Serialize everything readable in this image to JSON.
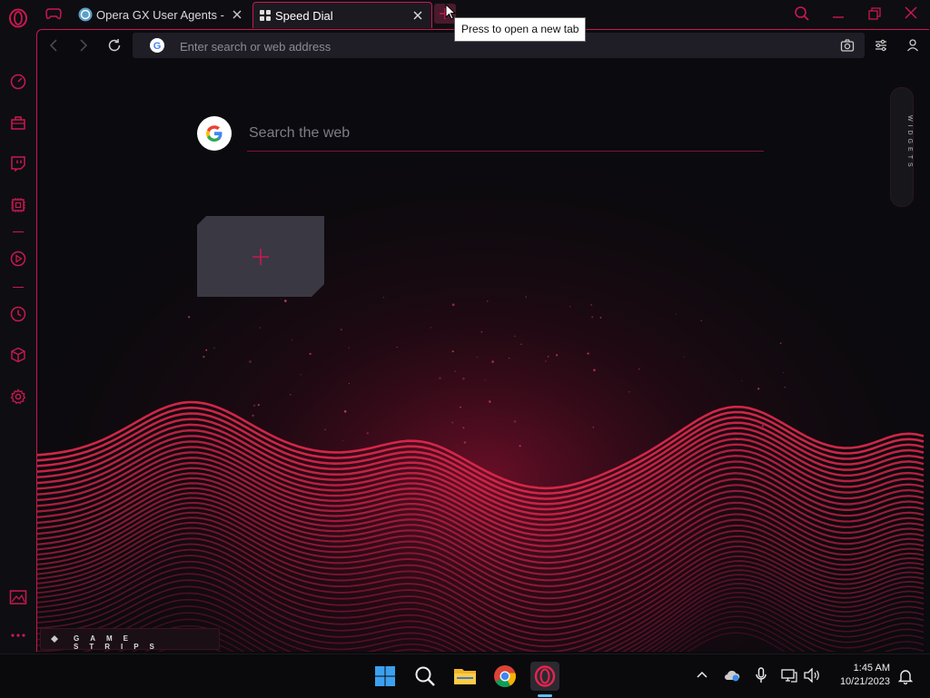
{
  "tabs": [
    {
      "label": "Opera GX User Agents - W"
    },
    {
      "label": "Speed Dial"
    }
  ],
  "tooltip": "Press to open a new tab",
  "address": {
    "placeholder": "Enter search or web address",
    "value": ""
  },
  "speed_dial": {
    "search_placeholder": "Search the web"
  },
  "widgets_label": "WIDGETS",
  "game_strips_label": "GAME STRIPS",
  "clock": {
    "time": "1:45 AM",
    "date": "10/21/2023"
  },
  "colors": {
    "accent": "#c8194f",
    "bg": "#0b0a0e",
    "panel": "#1f1e26"
  },
  "icons": {
    "sidebar": [
      "opera-gx-logo-icon",
      "speedometer-icon",
      "shopping-bag-icon",
      "twitch-icon",
      "cpu-icon",
      "player-icon",
      "history-icon",
      "extensions-cube-icon",
      "settings-gear-icon",
      "wallpaper-icon",
      "more-dots-icon"
    ],
    "taskbar": [
      "windows-start-icon",
      "search-icon",
      "file-explorer-icon",
      "chrome-icon",
      "opera-gx-icon"
    ]
  }
}
